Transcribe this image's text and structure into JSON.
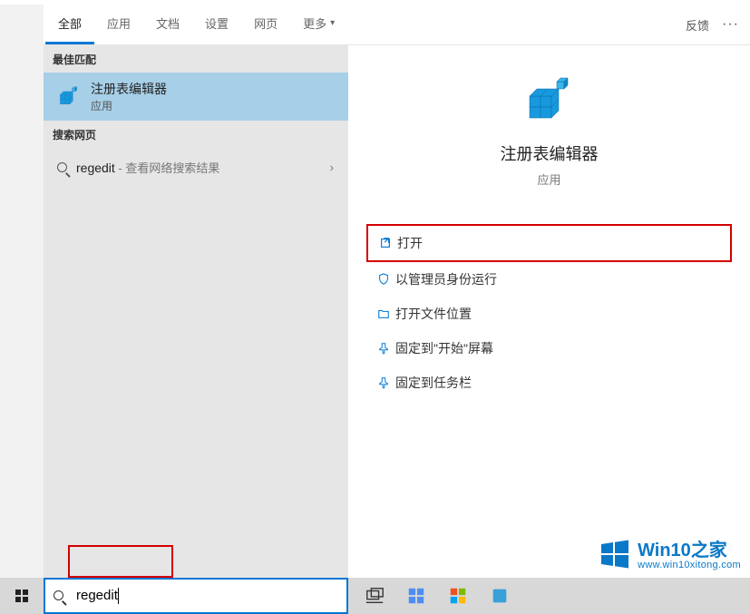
{
  "header": {
    "tabs": [
      {
        "label": "全部"
      },
      {
        "label": "应用"
      },
      {
        "label": "文档"
      },
      {
        "label": "设置"
      },
      {
        "label": "网页"
      },
      {
        "label": "更多"
      }
    ],
    "feedback": "反馈",
    "more_dots": "···"
  },
  "left": {
    "best_match_header": "最佳匹配",
    "best_match": {
      "title": "注册表编辑器",
      "subtitle": "应用"
    },
    "web_header": "搜索网页",
    "web_item": {
      "term": "regedit",
      "suffix": " - 查看网络搜索结果"
    }
  },
  "right": {
    "title": "注册表编辑器",
    "subtitle": "应用",
    "actions": [
      {
        "icon": "open-icon",
        "label": "打开"
      },
      {
        "icon": "admin-icon",
        "label": "以管理员身份运行"
      },
      {
        "icon": "folder-icon",
        "label": "打开文件位置"
      },
      {
        "icon": "pin-start-icon",
        "label": "固定到\"开始\"屏幕"
      },
      {
        "icon": "pin-taskbar-icon",
        "label": "固定到任务栏"
      }
    ]
  },
  "search": {
    "value": "regedit"
  },
  "watermark": {
    "brand_a": "Win10",
    "brand_b": "之家",
    "url": "www.win10xitong.com"
  }
}
